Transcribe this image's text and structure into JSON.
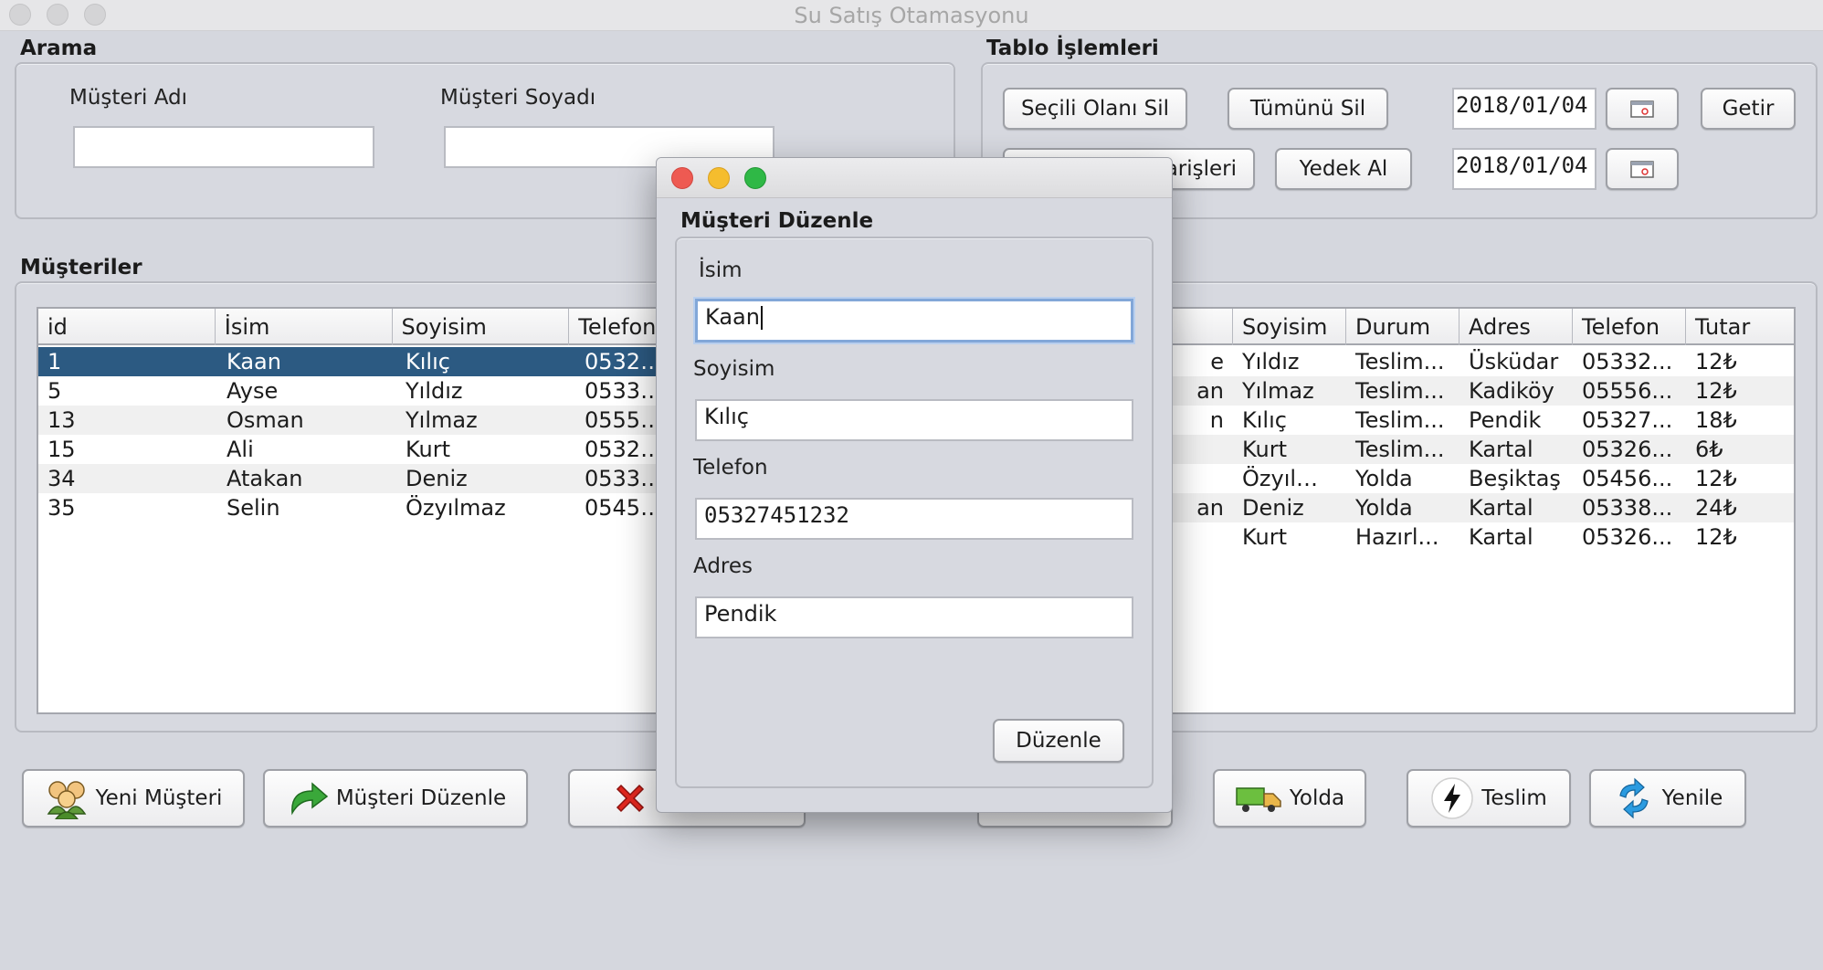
{
  "window": {
    "title": "Su Satış Otamasyonu"
  },
  "search": {
    "group_label": "Arama",
    "first_name_label": "Müşteri Adı",
    "last_name_label": "Müşteri Soyadı",
    "first_name_value": "",
    "last_name_value": ""
  },
  "table_ops": {
    "group_label": "Tablo İşlemleri",
    "delete_selected": "Seçili Olanı Sil",
    "delete_all": "Tümünü Sil",
    "orders_partial": "arişleri",
    "backup": "Yedek Al",
    "date1": "2018/01/04",
    "date2": "2018/01/04",
    "fetch": "Getir"
  },
  "customers": {
    "group_label": "Müşteriler",
    "columns": [
      "id",
      "İsim",
      "Soyisim",
      "Telefon"
    ],
    "rows": [
      [
        "1",
        "Kaan",
        "Kılıç",
        "05327451232"
      ],
      [
        "5",
        "Ayse",
        "Yıldız",
        "05332..."
      ],
      [
        "13",
        "Osman",
        "Yılmaz",
        "05556..."
      ],
      [
        "15",
        "Ali",
        "Kurt",
        "05326..."
      ],
      [
        "34",
        "Atakan",
        "Deniz",
        "05338..."
      ],
      [
        "35",
        "Selin",
        "Özyılmaz",
        "05456..."
      ]
    ]
  },
  "orders": {
    "columns": [
      "",
      "Soyisim",
      "Durum",
      "Adres",
      "Telefon",
      "Tutar"
    ],
    "rows": [
      [
        "e",
        "Yıldız",
        "Teslim...",
        "Üsküdar",
        "05332...",
        "12₺"
      ],
      [
        "an",
        "Yılmaz",
        "Teslim...",
        "Kadiköy",
        "05556...",
        "12₺"
      ],
      [
        "n",
        "Kılıç",
        "Teslim...",
        "Pendik",
        "05327...",
        "18₺"
      ],
      [
        "",
        "Kurt",
        "Teslim...",
        "Kartal",
        "05326...",
        "6₺"
      ],
      [
        "",
        "Özyılm...",
        "Yolda",
        "Beşiktaş",
        "05456...",
        "12₺"
      ],
      [
        "an",
        "Deniz",
        "Yolda",
        "Kartal",
        "05338...",
        "24₺"
      ],
      [
        "",
        "Kurt",
        "Hazırl...",
        "Kartal",
        "05326...",
        "12₺"
      ]
    ]
  },
  "bottom_buttons": {
    "new_customer": "Yeni Müşteri",
    "edit_customer": "Müşteri Düzenle",
    "on_the_way": "Yolda",
    "delivered": "Teslim",
    "refresh": "Yenile"
  },
  "dialog": {
    "group_label": "Müşteri Düzenle",
    "name_label": "İsim",
    "name_value": "Kaan",
    "surname_label": "Soyisim",
    "surname_value": "Kılıç",
    "phone_label": "Telefon",
    "phone_value": "05327451232",
    "address_label": "Adres",
    "address_value": "Pendik",
    "submit": "Düzenle"
  },
  "colors": {
    "selection": "#2c5a82",
    "close": "#ee5a52",
    "minimize": "#f5bd2e",
    "maximize": "#2fb846"
  }
}
